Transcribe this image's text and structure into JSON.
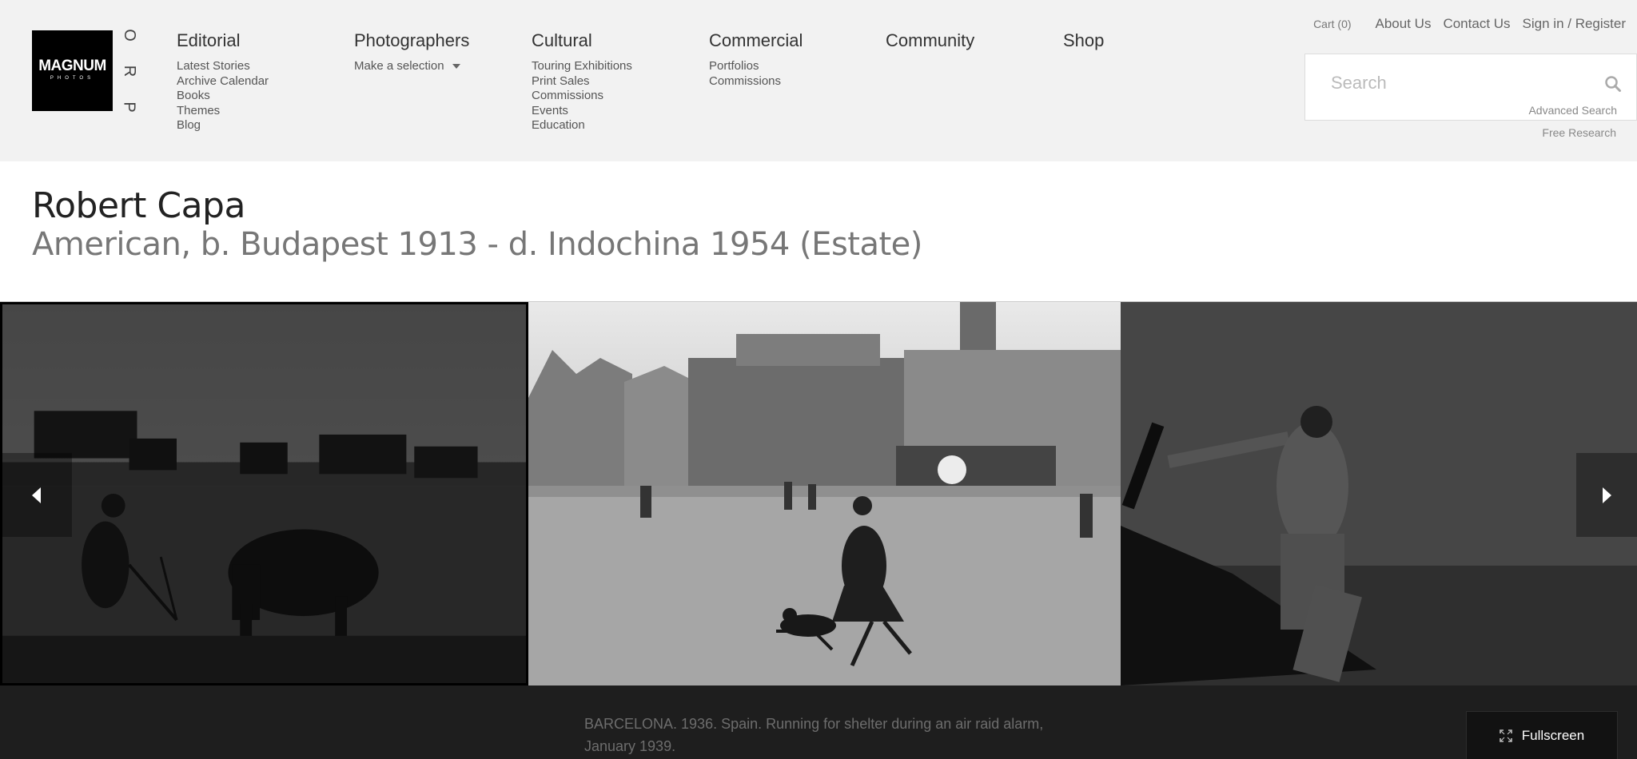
{
  "brand": {
    "logo_word": "MAGNUM",
    "logo_sub": "PHOTOS",
    "pro_letters": [
      "O",
      "R",
      "P"
    ]
  },
  "nav": {
    "editorial": {
      "label": "Editorial",
      "links": [
        "Latest Stories",
        "Archive Calendar",
        "Books",
        "Themes",
        "Blog"
      ]
    },
    "photographers": {
      "label": "Photographers",
      "select_label": "Make a selection"
    },
    "cultural": {
      "label": "Cultural",
      "links": [
        "Touring Exhibitions",
        "Print Sales",
        "Commissions",
        "Events",
        "Education"
      ]
    },
    "commercial": {
      "label": "Commercial",
      "links": [
        "Portfolios",
        "Commissions"
      ]
    },
    "community": {
      "label": "Community"
    },
    "shop": {
      "label": "Shop"
    }
  },
  "top_links": {
    "cart": "Cart (0)",
    "about": "About Us",
    "contact": "Contact Us",
    "signin": "Sign in / Register"
  },
  "search": {
    "placeholder": "Search",
    "advanced": "Advanced Search",
    "free_research": "Free Research"
  },
  "photographer": {
    "name": "Robert Capa",
    "bio": "American, b. Budapest 1913 - d. Indochina 1954 (Estate)"
  },
  "gallery": {
    "caption": "BARCELONA. 1936. Spain. Running for shelter during an air raid alarm, January 1939.",
    "fullscreen_label": "Fullscreen",
    "icons": {
      "prev": "arrow-left-icon",
      "next": "arrow-right-icon",
      "fullscreen": "expand-icon",
      "search": "search-icon"
    }
  }
}
